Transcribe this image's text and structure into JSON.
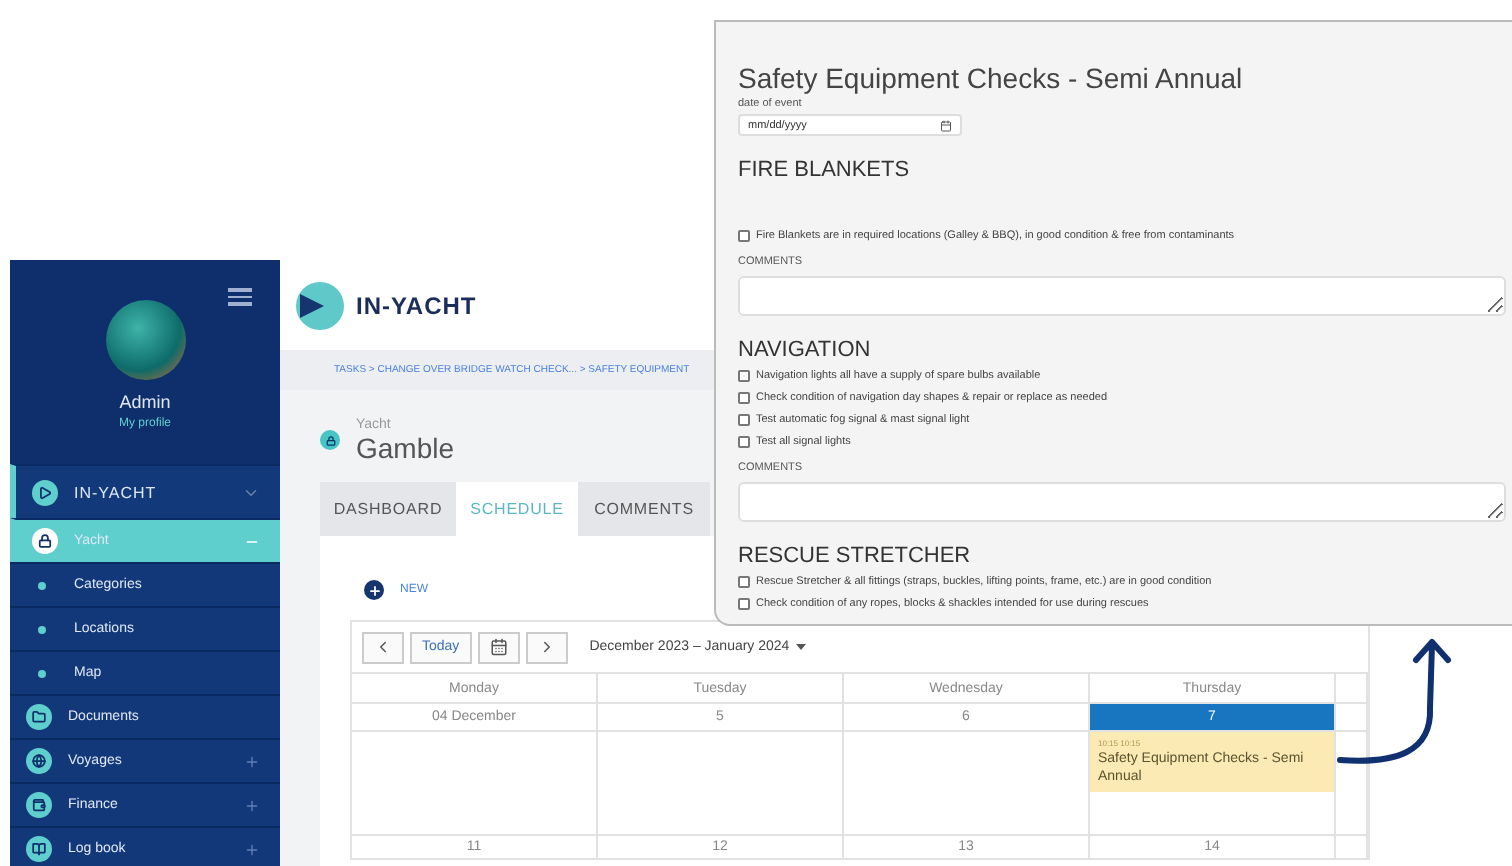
{
  "sidebar": {
    "profile": {
      "name": "Admin",
      "link": "My profile"
    },
    "items": [
      {
        "label": "IN-YACHT",
        "kind": "header",
        "expanded": true,
        "selected": false
      },
      {
        "label": "Yacht",
        "kind": "folder",
        "expanded": true,
        "selected": true
      },
      {
        "label": "Categories",
        "kind": "link",
        "selected": false
      },
      {
        "label": "Locations",
        "kind": "link",
        "selected": false
      },
      {
        "label": "Map",
        "kind": "link",
        "selected": false
      },
      {
        "label": "Documents",
        "kind": "page",
        "selected": false
      },
      {
        "label": "Voyages",
        "kind": "folder",
        "expanded": false,
        "selected": false
      },
      {
        "label": "Finance",
        "kind": "folder",
        "expanded": false,
        "selected": false
      },
      {
        "label": "Log book",
        "kind": "folder",
        "expanded": false,
        "selected": false
      }
    ]
  },
  "header": {
    "brand": "IN-YACHT"
  },
  "breadcrumb": "TASKS > CHANGE OVER BRIDGE WATCH CHECK... > SAFETY EQUIPMENT",
  "record": {
    "type": "Yacht",
    "name": "Gamble"
  },
  "tabs": [
    {
      "label": "DASHBOARD",
      "selected": false
    },
    {
      "label": "SCHEDULE",
      "selected": true
    },
    {
      "label": "COMMENTS",
      "selected": false
    }
  ],
  "new_button": "NEW",
  "calendar": {
    "today": "Today",
    "range": "December 2023 – January 2024",
    "weekdays": [
      "Monday",
      "Tuesday",
      "Wednesday",
      "Thursday"
    ],
    "days": [
      {
        "date": "04 December",
        "selected": false
      },
      {
        "date": "5",
        "selected": false
      },
      {
        "date": "6",
        "selected": false
      },
      {
        "date": "7",
        "selected": true,
        "events": [
          {
            "time": "10:15 10:15",
            "title": "Safety Equipment Checks - Semi Annual"
          }
        ]
      }
    ],
    "next_week": [
      "11",
      "12",
      "13",
      "14"
    ]
  },
  "popup": {
    "title": "Safety Equipment Checks - Semi Annual",
    "date_label": "date of event",
    "date_placeholder": "mm/dd/yyyy",
    "sections": [
      {
        "heading": "FIRE BLANKETS",
        "checks": [
          {
            "label": "Fire Blankets are in required locations (Galley & BBQ), in good condition & free from contaminants",
            "checked": false
          }
        ],
        "comments_label": "COMMENTS"
      },
      {
        "heading": "NAVIGATION",
        "checks": [
          {
            "label": "Navigation lights all have a supply of spare bulbs available",
            "checked": false
          },
          {
            "label": "Check condition of navigation day shapes & repair or replace as needed",
            "checked": false
          },
          {
            "label": "Test automatic fog signal & mast signal light",
            "checked": false
          },
          {
            "label": "Test all signal lights",
            "checked": false
          }
        ],
        "comments_label": "COMMENTS"
      },
      {
        "heading": "RESCUE STRETCHER",
        "checks": [
          {
            "label": "Rescue Stretcher & all fittings (straps, buckles, lifting points, frame, etc.) are in good condition",
            "checked": false
          },
          {
            "label": "Check condition of any ropes, blocks & shackles intended for use during rescues",
            "checked": false
          }
        ]
      }
    ]
  }
}
